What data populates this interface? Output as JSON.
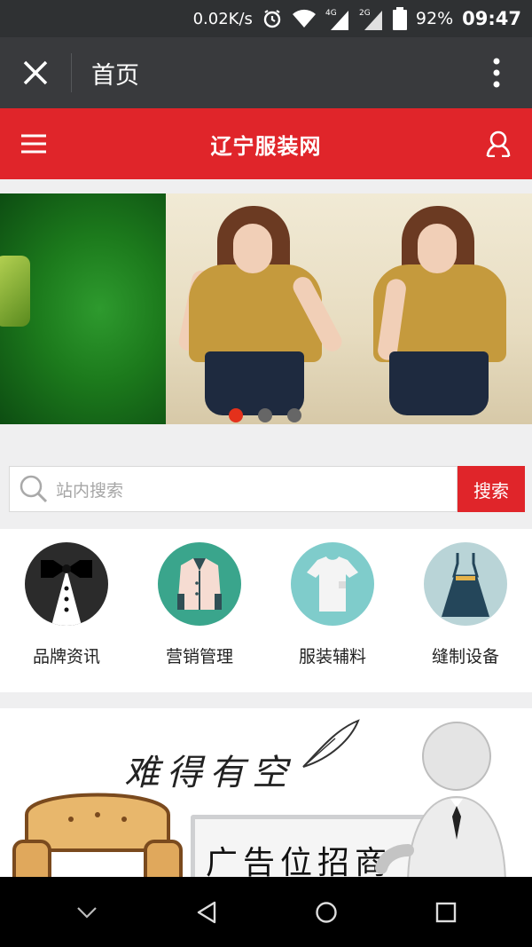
{
  "status_bar": {
    "net_speed": "0.02K/s",
    "net_4g": "4G",
    "net_2g": "2G",
    "battery": "92%",
    "time": "09:47"
  },
  "app_bar": {
    "title": "首页"
  },
  "site_header": {
    "title": "辽宁服装网"
  },
  "banner": {
    "slides": 3,
    "active_slide": 1
  },
  "search": {
    "placeholder": "站内搜索",
    "button_label": "搜索"
  },
  "categories": [
    {
      "label": "品牌资讯",
      "icon": "tuxedo-icon",
      "color": "#2b2b2b"
    },
    {
      "label": "营销管理",
      "icon": "coat-icon",
      "color": "#3aa58c"
    },
    {
      "label": "服装辅料",
      "icon": "tshirt-icon",
      "color": "#7fcccb"
    },
    {
      "label": "缝制设备",
      "icon": "dress-icon",
      "color": "#b9d4d7"
    }
  ],
  "ad": {
    "slogan": "难得有空",
    "board_text": "广告位招商"
  },
  "colors": {
    "brand_red": "#e0252a",
    "appbar_dark": "#393a3d",
    "dot_active": "#e4311b"
  }
}
